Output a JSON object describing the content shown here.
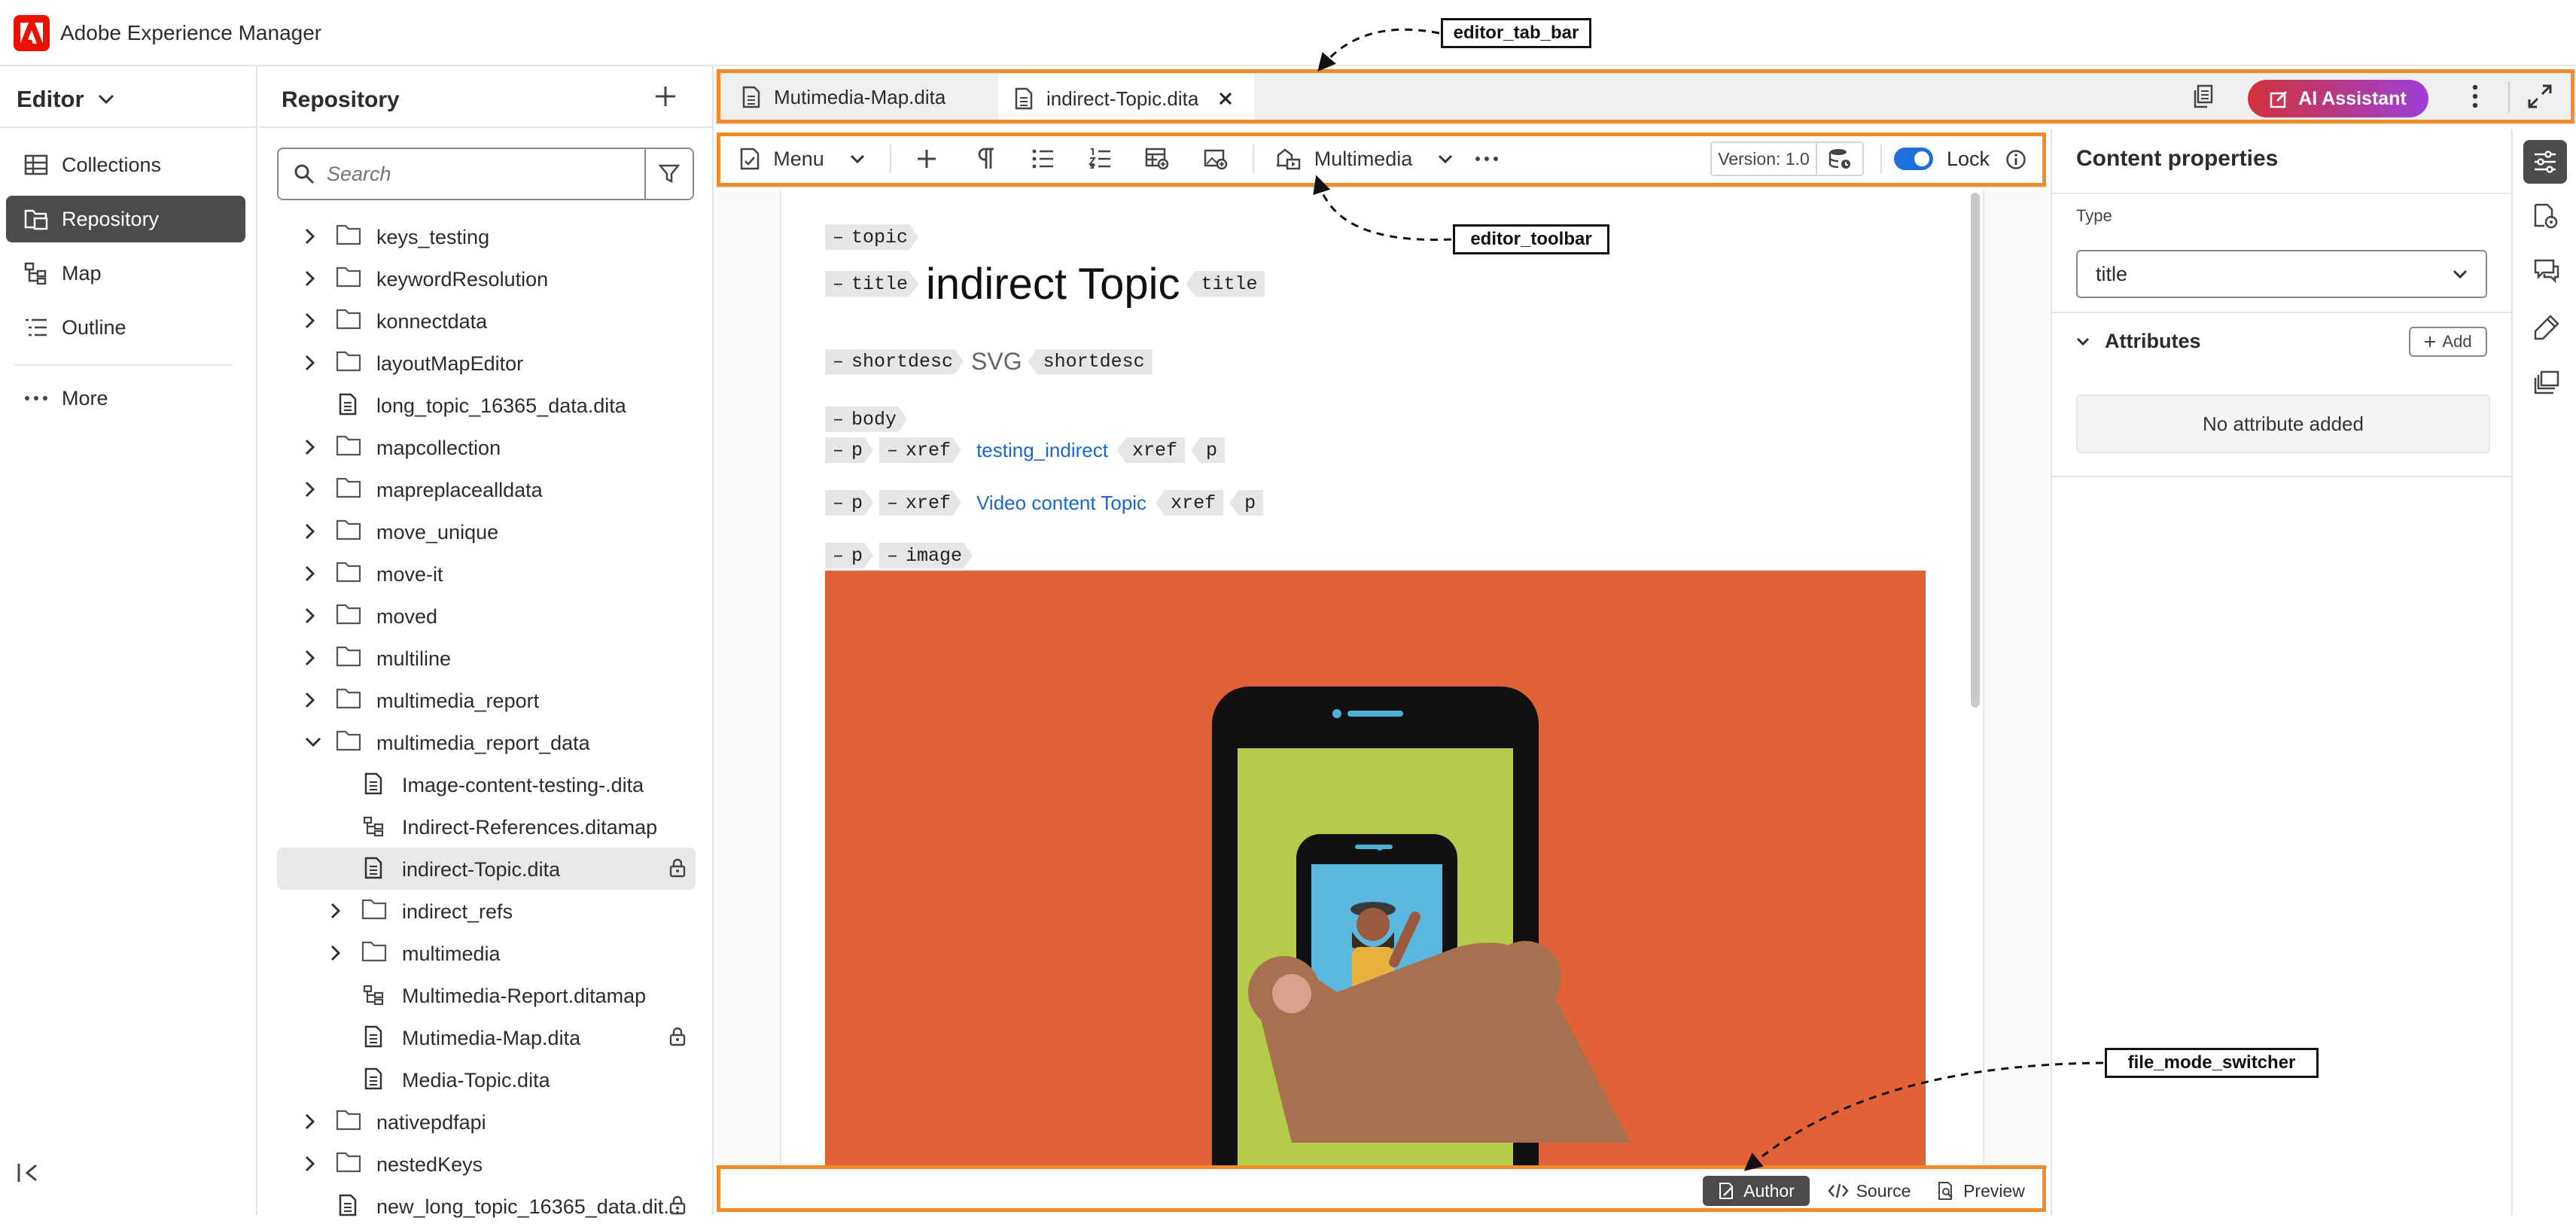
{
  "app": {
    "title": "Adobe Experience Manager",
    "logo_icon": "adobe-logo"
  },
  "nav": {
    "mode_label": "Editor",
    "items": [
      {
        "label": "Collections",
        "icon": "collections-icon"
      },
      {
        "label": "Repository",
        "icon": "repository-icon",
        "active": true
      },
      {
        "label": "Map",
        "icon": "map-icon"
      },
      {
        "label": "Outline",
        "icon": "outline-icon"
      },
      {
        "label": "More",
        "icon": "more-icon"
      }
    ]
  },
  "repository": {
    "title": "Repository",
    "search_placeholder": "Search",
    "tree": [
      {
        "label": "keys_testing",
        "type": "folder",
        "level": 0,
        "expanded": false
      },
      {
        "label": "keywordResolution",
        "type": "folder",
        "level": 0,
        "expanded": false
      },
      {
        "label": "konnectdata",
        "type": "folder",
        "level": 0,
        "expanded": false
      },
      {
        "label": "layoutMapEditor",
        "type": "folder",
        "level": 0,
        "expanded": false
      },
      {
        "label": "long_topic_16365_data.dita",
        "type": "file",
        "level": 0
      },
      {
        "label": "mapcollection",
        "type": "folder",
        "level": 0,
        "expanded": false
      },
      {
        "label": "mapreplacealldata",
        "type": "folder",
        "level": 0,
        "expanded": false
      },
      {
        "label": "move_unique",
        "type": "folder",
        "level": 0,
        "expanded": false
      },
      {
        "label": "move-it",
        "type": "folder",
        "level": 0,
        "expanded": false
      },
      {
        "label": "moved",
        "type": "folder",
        "level": 0,
        "expanded": false
      },
      {
        "label": "multiline",
        "type": "folder",
        "level": 0,
        "expanded": false
      },
      {
        "label": "multimedia_report",
        "type": "folder",
        "level": 0,
        "expanded": false
      },
      {
        "label": "multimedia_report_data",
        "type": "folder",
        "level": 0,
        "expanded": true
      },
      {
        "label": "Image-content-testing-.dita",
        "type": "file",
        "level": 1
      },
      {
        "label": "Indirect-References.ditamap",
        "type": "map",
        "level": 1
      },
      {
        "label": "indirect-Topic.dita",
        "type": "file",
        "level": 1,
        "selected": true,
        "locked": true
      },
      {
        "label": "indirect_refs",
        "type": "folder",
        "level": 1,
        "expanded": false
      },
      {
        "label": "multimedia",
        "type": "folder",
        "level": 1,
        "expanded": false
      },
      {
        "label": "Multimedia-Report.ditamap",
        "type": "map",
        "level": 1
      },
      {
        "label": "Mutimedia-Map.dita",
        "type": "file",
        "level": 1,
        "locked": true
      },
      {
        "label": "Media-Topic.dita",
        "type": "file",
        "level": 1
      },
      {
        "label": "nativepdfapi",
        "type": "folder",
        "level": 0,
        "expanded": false
      },
      {
        "label": "nestedKeys",
        "type": "folder",
        "level": 0,
        "expanded": false
      },
      {
        "label": "new_long_topic_16365_data.dit...",
        "type": "file",
        "level": 0,
        "locked": true
      }
    ]
  },
  "tabs": [
    {
      "label": "Mutimedia-Map.dita",
      "active": false
    },
    {
      "label": "indirect-Topic.dita",
      "active": true
    }
  ],
  "tabbar_actions": {
    "ai_label": "AI Assistant"
  },
  "toolbar": {
    "menu_label": "Menu",
    "multimedia_label": "Multimedia",
    "version_label": "Version: 1.0",
    "lock_label": "Lock",
    "lock_on": true
  },
  "doc": {
    "topic_tag": "topic",
    "title_tag": "title",
    "title_text": "indirect Topic",
    "shortdesc_tag": "shortdesc",
    "shortdesc_text": "SVG",
    "body_tag": "body",
    "p_tag": "p",
    "xref_tag": "xref",
    "image_tag": "image",
    "link1": "testing_indirect",
    "link2": "Video content Topic"
  },
  "footer": {
    "modes": [
      {
        "label": "Author",
        "active": true
      },
      {
        "label": "Source"
      },
      {
        "label": "Preview"
      }
    ]
  },
  "properties": {
    "title": "Content properties",
    "type_label": "Type",
    "type_value": "title",
    "attributes_label": "Attributes",
    "add_label": "Add",
    "no_attr_text": "No attribute added"
  },
  "annotations": {
    "tab_bar": "editor_tab_bar",
    "toolbar": "editor_toolbar",
    "switcher": "file_mode_switcher"
  },
  "colors": {
    "accent": "#f28c28",
    "ai_button": "#d2323a",
    "link": "#1a66d1",
    "illustration_bg": "#e06236",
    "phone_screen": "#b5cc4a"
  }
}
